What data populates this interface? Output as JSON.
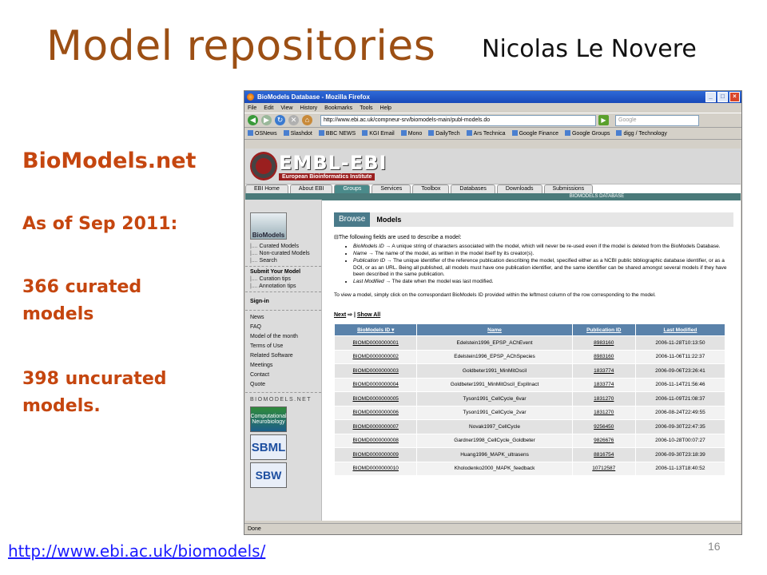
{
  "slide": {
    "title": "Model repositories",
    "author": "Nicolas Le Novere",
    "left_heading": "BioModels.net",
    "as_of": "As of Sep 2011:",
    "curated": "366 curated models",
    "uncurated": "398 uncurated models.",
    "url": "http://www.ebi.ac.uk/biomodels/",
    "page_number": "16"
  },
  "browser": {
    "title": "BioModels Database - Mozilla Firefox",
    "menu": [
      "File",
      "Edit",
      "View",
      "History",
      "Bookmarks",
      "Tools",
      "Help"
    ],
    "address": "http://www.ebi.ac.uk/compneur-srv/biomodels-main/publ-models.do",
    "search_placeholder": "Google",
    "bookmarks": [
      "OSNews",
      "Slashdot",
      "BBC NEWS",
      "KGI Email",
      "Mono",
      "DailyTech",
      "Ars Technica",
      "Google Finance",
      "Google Groups",
      "digg / Technology"
    ],
    "status": "Done"
  },
  "site": {
    "logo": "EMBL-EBI",
    "logo_sub": "European Bioinformatics Institute",
    "tabs": [
      "EBI Home",
      "About EBI",
      "Groups",
      "Services",
      "Toolbox",
      "Databases",
      "Downloads",
      "Submissions"
    ],
    "db_label": "BIOMODELS DATABASE",
    "side_logo": "BioModels",
    "nav1": [
      "Curated Models",
      "Non-curated Models",
      "Search"
    ],
    "nav_head2": "Submit Your Model",
    "nav2": [
      "Curation tips",
      "Annotation tips"
    ],
    "nav_head3": "Sign-in",
    "nav3": [
      "News",
      "FAQ",
      "Model of the month",
      "Terms of Use",
      "Related Software",
      "Meetings",
      "Contact",
      "Quote"
    ],
    "brand": "BIOMODELS.NET",
    "logo_cn": "Computational Neurobiology",
    "logo_sbml": "SBML",
    "logo_sbw": "SBW"
  },
  "page": {
    "browse_tab": "Browse",
    "section_title": "Models",
    "intro": "The following fields are used to describe a model:",
    "fields": [
      {
        "name": "BioModels ID",
        "desc": "A unique string of characters associated with the model, which will never be re-used even if the model is deleted from the BioModels Database."
      },
      {
        "name": "Name",
        "desc": "The name of the model, as written in the model itself by its creator(s)."
      },
      {
        "name": "Publication ID",
        "desc": "The unique identifier of the reference publication describing the model, specified either as a NCBI public bibliographic database identifier, or as a DOI, or as an URL. Being all published, all models must have one publication identifier, and the same identifier can be shared amongst several models if they have been described in the same publication."
      },
      {
        "name": "Last Modified",
        "desc": "The date when the model was last modified."
      }
    ],
    "howto": "To view a model, simply click on the correspondant BioModels ID provided within the leftmost column of the row corresponding to the model.",
    "next": "Next",
    "show_all": "Show All",
    "columns": [
      "BioModels ID",
      "Name",
      "Publication ID",
      "Last Modified"
    ],
    "rows": [
      [
        "BIOMD0000000001",
        "Edelstein1996_EPSP_AChEvent",
        "8983160",
        "2006-11-28T10:13:50"
      ],
      [
        "BIOMD0000000002",
        "Edelstein1996_EPSP_AChSpecies",
        "8983160",
        "2006-11-06T11:22:37"
      ],
      [
        "BIOMD0000000003",
        "Goldbeter1991_MinMitOscil",
        "1833774",
        "2006-09-06T23:26:41"
      ],
      [
        "BIOMD0000000004",
        "Goldbeter1991_MinMitOscil_ExplInact",
        "1833774",
        "2006-11-14T21:56:46"
      ],
      [
        "BIOMD0000000005",
        "Tyson1991_CellCycle_6var",
        "1831270",
        "2006-11-09T21:08:37"
      ],
      [
        "BIOMD0000000006",
        "Tyson1991_CellCycle_2var",
        "1831270",
        "2006-08-24T22:49:55"
      ],
      [
        "BIOMD0000000007",
        "Novak1997_CellCycle",
        "9256450",
        "2006-09-30T22:47:35"
      ],
      [
        "BIOMD0000000008",
        "Gardner1998_CellCycle_Goldbeter",
        "9826676",
        "2006-10-28T00:07:27"
      ],
      [
        "BIOMD0000000009",
        "Huang1996_MAPK_ultrasens",
        "8816754",
        "2006-09-30T23:18:39"
      ],
      [
        "BIOMD0000000010",
        "Kholodenko2000_MAPK_feedback",
        "10712587",
        "2006-11-13T18:40:52"
      ]
    ]
  },
  "colors": {
    "title": "#9c4f14",
    "left_text": "#c5460f",
    "link": "#1a1aff",
    "table_header": "#5a82aa"
  }
}
